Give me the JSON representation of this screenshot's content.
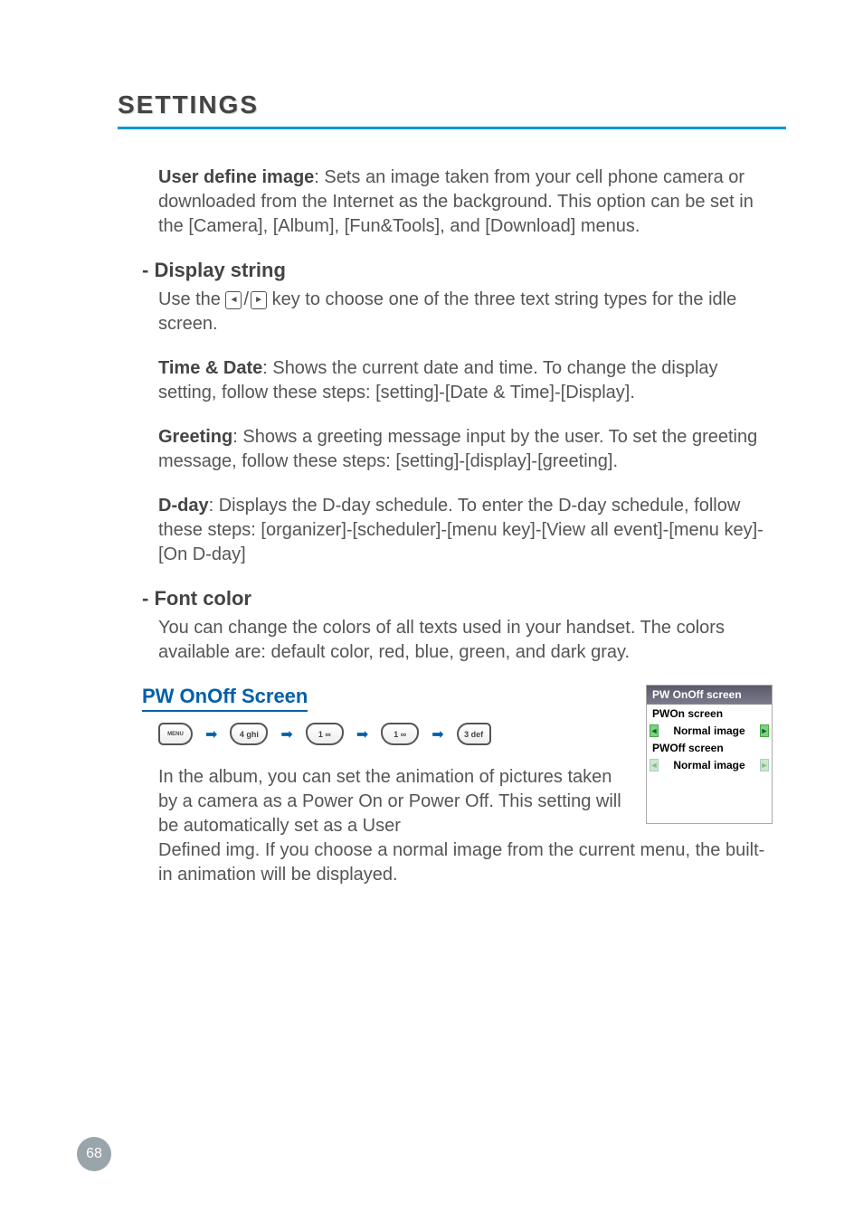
{
  "page": {
    "header": "SETTINGS",
    "number": "68"
  },
  "paragraphs": {
    "user_define_bold": "User define image",
    "user_define_rest": ": Sets an image taken from your cell phone camera or downloaded from the Internet as the background. This option can be set in the [Camera], [Album], [Fun&Tools], and [Download] menus.",
    "display_string_heading": "- Display string",
    "display_string_pre": "Use the ",
    "display_string_post": " key to choose one of the three text string types for the idle screen.",
    "time_date_bold": "Time & Date",
    "time_date_rest": ": Shows the current date and time. To change the display setting, follow these steps: [setting]-[Date & Time]-[Display].",
    "greeting_bold": "Greeting",
    "greeting_rest": ": Shows a greeting message input by the user. To set the greeting message, follow these steps: [setting]-[display]-[greeting].",
    "dday_bold": "D-day",
    "dday_rest": ": Displays the D-day schedule. To enter the D-day schedule, follow these steps: [organizer]-[scheduler]-[menu key]-[View all event]-[menu key]-[On D-day]",
    "font_color_heading": "- Font color",
    "font_color_body": "You can change the colors of all texts used in your handset. The colors available are: default color, red, blue, green, and dark gray.",
    "pw_onoff_title": "PW OnOff Screen",
    "pw_onoff_body_left": "In the album, you can set the animation of pictures taken by a camera as a Power On or Power Off. This setting will be automatically set as a User",
    "pw_onoff_body_after": "Defined img. If you choose a normal image from the current menu, the built-in animation will be displayed."
  },
  "keys": {
    "menu": "MENU",
    "k4": "4 ghi",
    "k1a": "1 ∞",
    "k1b": "1 ∞",
    "k3": "3 def",
    "nav_left": "◄",
    "nav_right": "►",
    "slash": "/"
  },
  "screenshot": {
    "title": "PW OnOff screen",
    "label1": "PWOn screen",
    "value1": "Normal image",
    "label2": "PWOff screen",
    "value2": "Normal image",
    "tri_left": "◄",
    "tri_right": "►"
  }
}
